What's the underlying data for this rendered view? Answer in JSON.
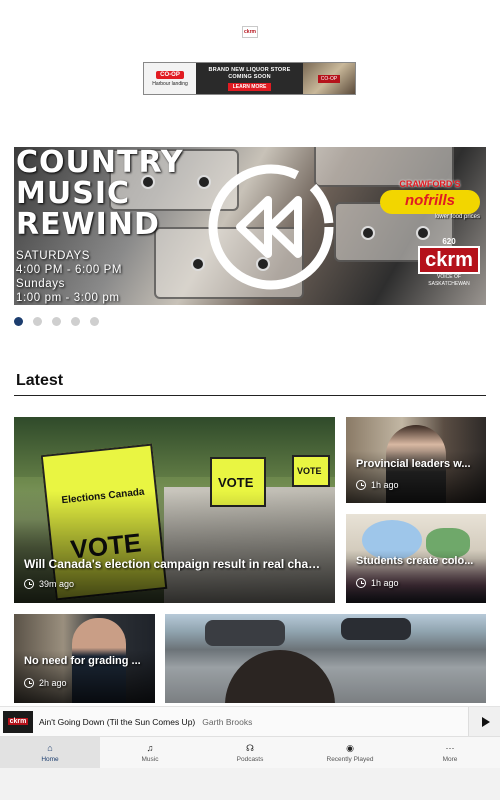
{
  "top_logo": {
    "text": "ckrm"
  },
  "ad": {
    "brand": "CO-OP",
    "location": "Harbour landing",
    "headline": "BRAND NEW LIQUOR STORE COMING SOON",
    "cta": "LEARN MORE",
    "store_sign": "CO-OP"
  },
  "hero": {
    "title": "COUNTRY\nMUSIC\nREWIND",
    "schedule": [
      "SATURDAYS",
      "4:00 PM - 6:00 PM",
      "Sundays",
      "1:00 pm - 3:00 pm"
    ],
    "sponsor": {
      "name": "CRAWFORD'S",
      "brand": "nofrills",
      "tagline": "lower food prices"
    },
    "station": {
      "freq": "620",
      "call": "ckrm",
      "sub": "VOICE OF SASKATCHEWAN"
    },
    "slides_total": 5,
    "slide_active": 1
  },
  "latest": {
    "heading": "Latest",
    "cards": [
      {
        "title": "Will Canada's election campaign result in real change?",
        "time": "39m ago"
      },
      {
        "title": "Provincial leaders w...",
        "time": "1h ago"
      },
      {
        "title": "Students create colo...",
        "time": "1h ago"
      },
      {
        "title": "No need for grading ...",
        "time": "2h ago"
      }
    ],
    "sign_text": {
      "brand": "Elections Canada",
      "word": "VOTE"
    }
  },
  "player": {
    "art_label": "ckrm",
    "track": "Ain't Going Down (Til the Sun Comes Up)",
    "artist": "Garth Brooks"
  },
  "nav": {
    "items": [
      {
        "label": "Home",
        "icon": "home-icon",
        "glyph": "⌂",
        "active": true
      },
      {
        "label": "Music",
        "icon": "music-icon",
        "glyph": "♫",
        "active": false
      },
      {
        "label": "Podcasts",
        "icon": "headphones-icon",
        "glyph": "☊",
        "active": false
      },
      {
        "label": "Recently Played",
        "icon": "radio-icon",
        "glyph": "◉",
        "active": false
      },
      {
        "label": "More",
        "icon": "more-icon",
        "glyph": "···",
        "active": false
      }
    ]
  },
  "colors": {
    "accent": "#1c3d6e",
    "brand_red": "#b5121b",
    "vote_yellow": "#e9f542"
  }
}
